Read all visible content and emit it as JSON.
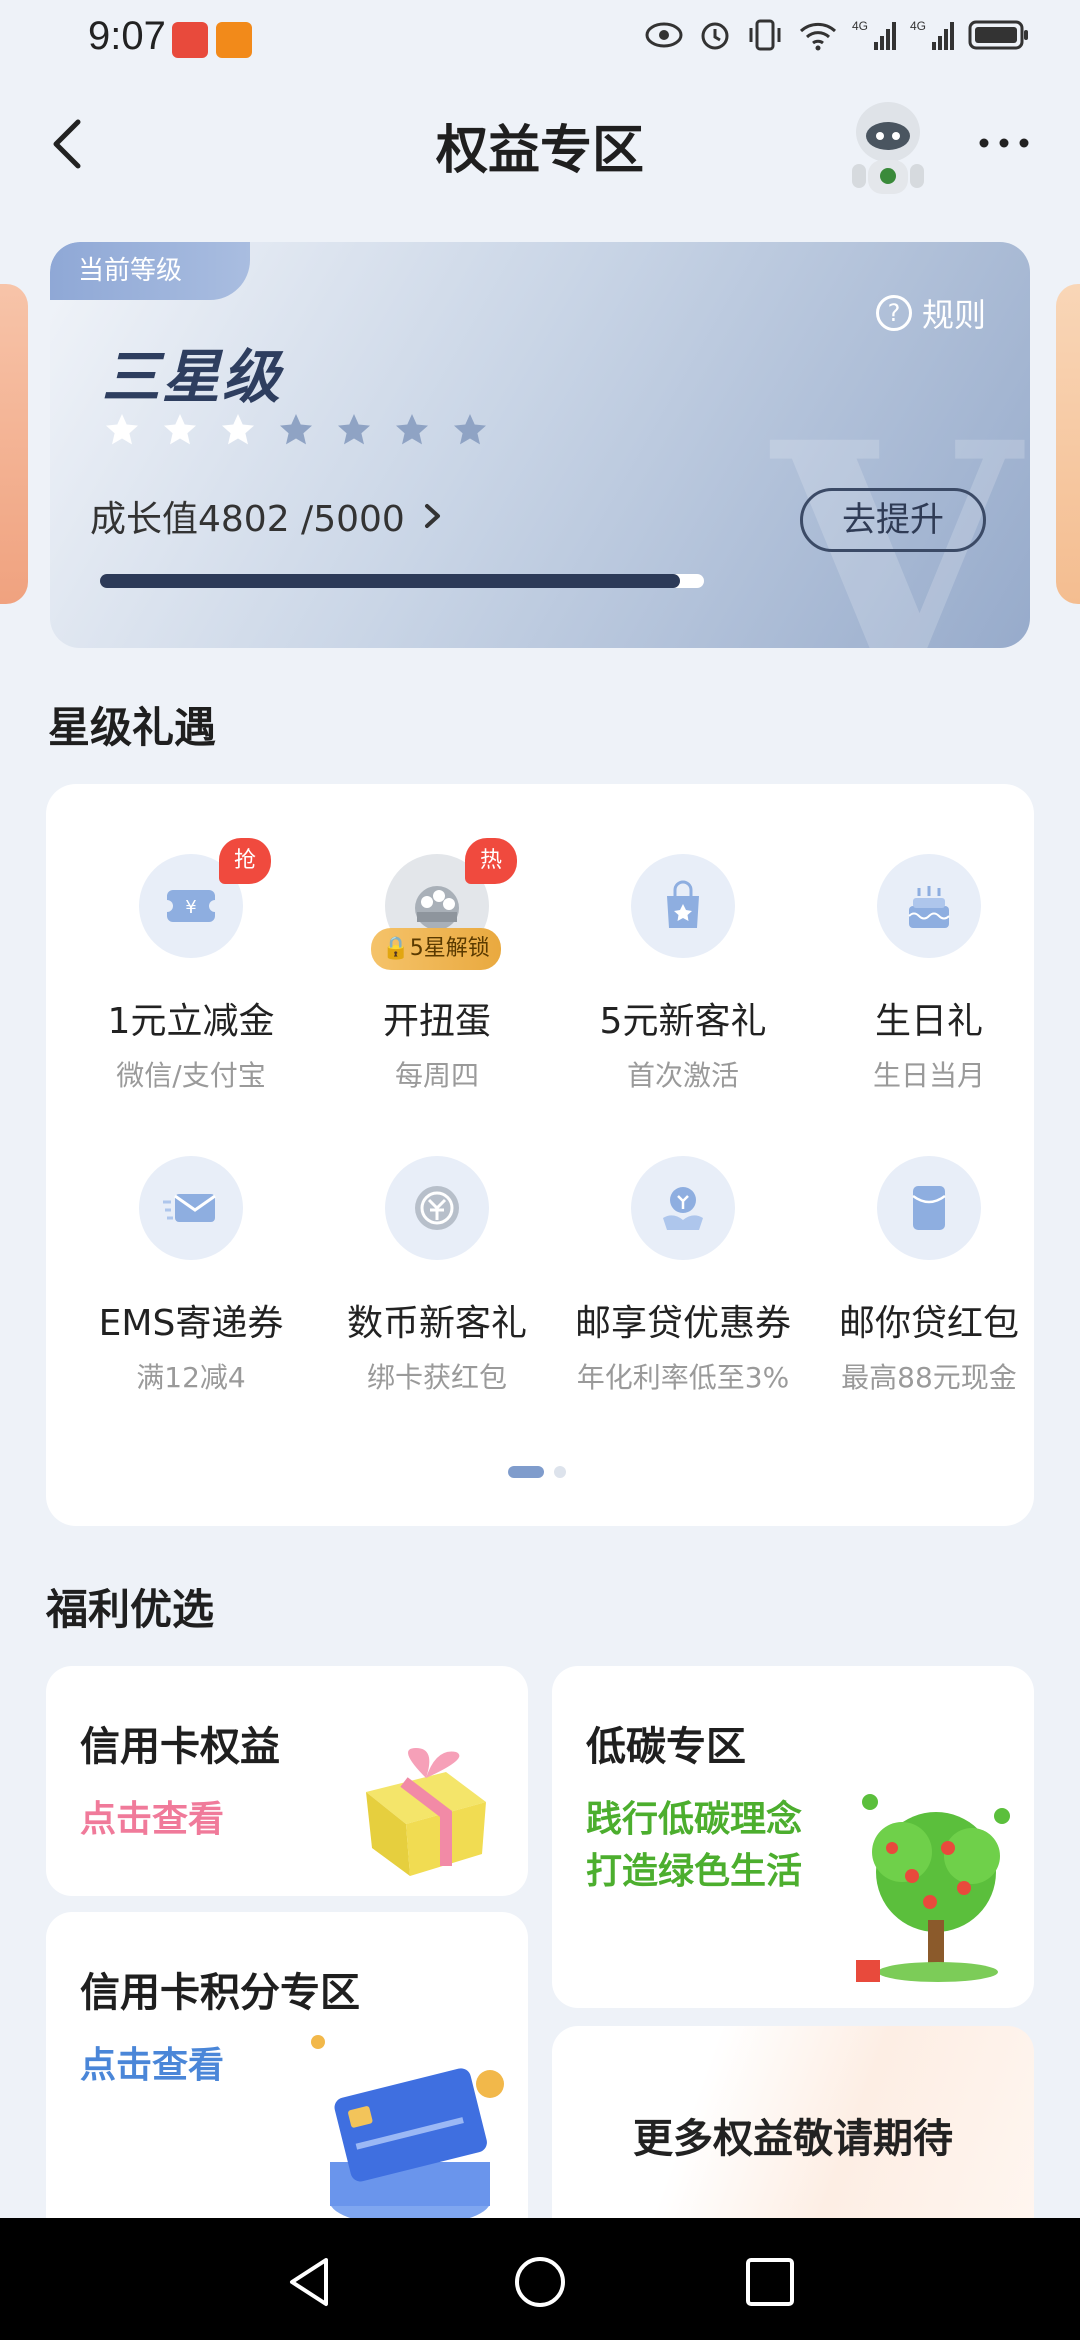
{
  "status_bar": {
    "time": "9:07"
  },
  "header": {
    "title": "权益专区"
  },
  "level_card": {
    "tab_label": "当前等级",
    "rules_label": "规则",
    "level_name": "三星级",
    "stars_total": 7,
    "stars_filled": 3,
    "growth_text": "成长值4802 /5000",
    "growth_value": 4802,
    "growth_max": 5000,
    "upgrade_label": "去提升"
  },
  "section_star_gifts": {
    "title": "星级礼遇"
  },
  "benefits": [
    {
      "title": "1元立减金",
      "sub": "微信/支付宝",
      "badge": "抢",
      "icon": "coupon-icon"
    },
    {
      "title": "开扭蛋",
      "sub": "每周四",
      "badge": "热",
      "lock": "5星解锁",
      "icon": "gacha-icon"
    },
    {
      "title": "5元新客礼",
      "sub": "首次激活",
      "icon": "shopping-bag-icon"
    },
    {
      "title": "生日礼",
      "sub": "生日当月",
      "icon": "birthday-cake-icon"
    },
    {
      "title": "EMS寄递券",
      "sub": "满12减4",
      "icon": "envelope-icon"
    },
    {
      "title": "数币新客礼",
      "sub": "绑卡获红包",
      "icon": "digital-currency-icon"
    },
    {
      "title": "邮享贷优惠券",
      "sub": "年化利率低至3%",
      "icon": "loan-coupon-icon"
    },
    {
      "title": "邮你贷红包",
      "sub": "最高88元现金",
      "icon": "red-packet-icon"
    }
  ],
  "section_welfare": {
    "title": "福利优选"
  },
  "welfare_cards": {
    "credit_card": {
      "title": "信用卡权益",
      "link": "点击查看"
    },
    "low_carbon": {
      "title": "低碳专区",
      "line1": "践行低碳理念",
      "line2": "打造绿色生活"
    },
    "credit_points": {
      "title": "信用卡积分专区",
      "link": "点击查看"
    },
    "more": {
      "title": "更多权益敬请期待"
    }
  },
  "colors": {
    "page_bg": "#eef2f8",
    "pink_link": "#f07a9a",
    "blue_link": "#4a86d8",
    "green_text": "#4cae2e",
    "badge_red": "#f04a3e"
  }
}
